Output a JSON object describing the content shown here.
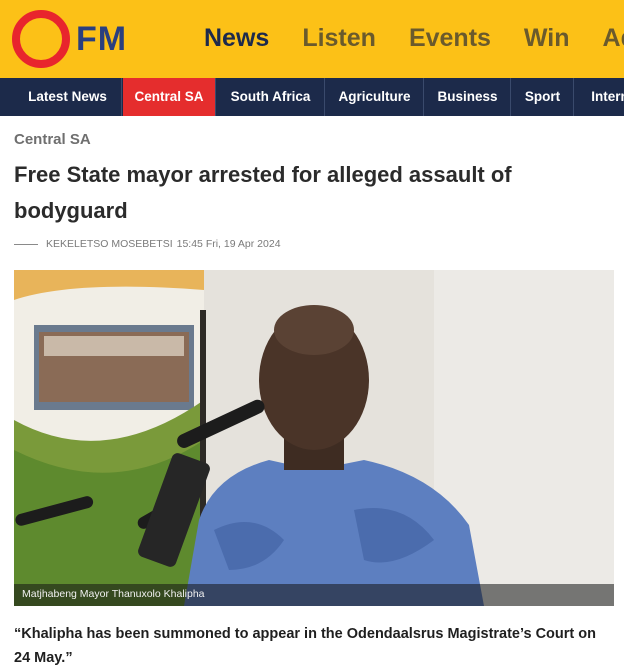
{
  "brand": {
    "logo_text": "FM",
    "logo_color": "#e8252d",
    "text_color": "#2a3f7f",
    "bar_color": "#fcc117"
  },
  "main_nav": {
    "items": [
      "News",
      "Listen",
      "Events",
      "Win",
      "Adv"
    ],
    "active": "News"
  },
  "sub_nav": {
    "bg": "#1c2a4a",
    "active_color": "#e52d2d",
    "items": [
      "Latest News",
      "Central SA",
      "South Africa",
      "Agriculture",
      "Business",
      "Sport",
      "Intern"
    ],
    "active": "Central SA"
  },
  "article": {
    "category": "Central SA",
    "headline": "Free State mayor arrested for alleged assault of bodyguard",
    "author": "KEKELETSO MOSEBETSI",
    "date": "15:45 Fri, 19 Apr 2024",
    "image_caption": "Matjhabeng Mayor Thanuxolo Khalipha",
    "quote": "“Khalipha has been summoned to appear in the Odendaalsrus Magistrate’s Court on 24 May.”"
  }
}
